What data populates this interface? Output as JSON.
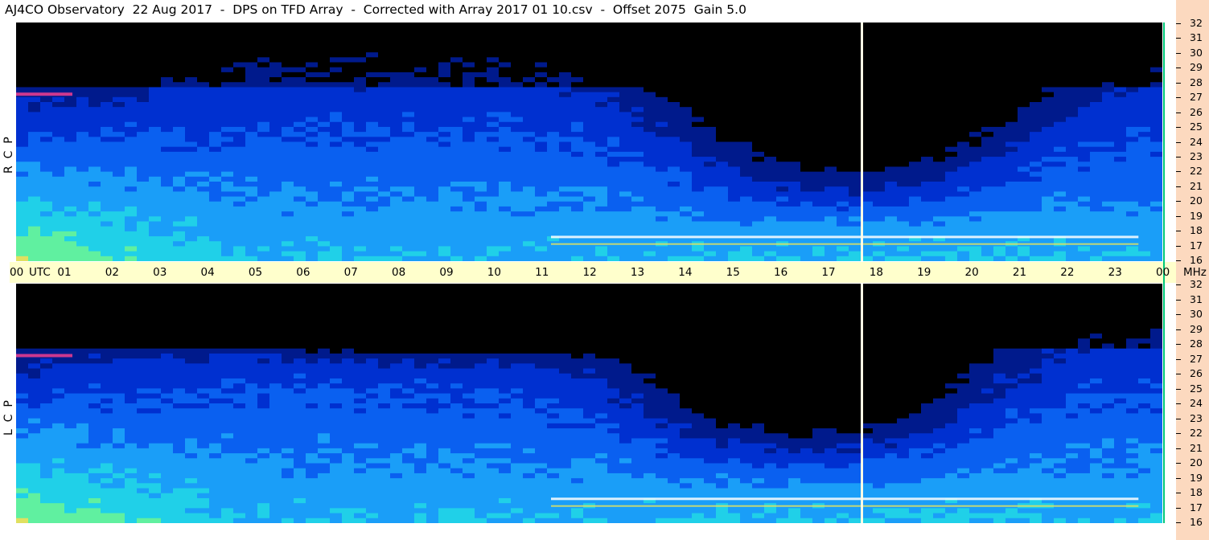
{
  "title": "AJ4CO Observatory  22 Aug 2017  -  DPS on TFD Array  -  Corrected with Array 2017 01 10.csv  -  Offset 2075  Gain 5.0",
  "chart_data": {
    "type": "heatmap",
    "title": "AJ4CO Observatory  22 Aug 2017  -  DPS on TFD Array  -  Corrected with Array 2017 01 10.csv  -  Offset 2075  Gain 5.0",
    "x_unit": "UTC",
    "y_unit": "MHz",
    "x_ticks": [
      "00",
      "01",
      "02",
      "03",
      "04",
      "05",
      "06",
      "07",
      "08",
      "09",
      "10",
      "11",
      "12",
      "13",
      "14",
      "15",
      "16",
      "17",
      "18",
      "19",
      "20",
      "21",
      "22",
      "23",
      "00"
    ],
    "y_ticks": [
      32,
      31,
      30,
      29,
      28,
      27,
      26,
      25,
      24,
      23,
      22,
      21,
      20,
      19,
      18,
      17,
      16
    ],
    "xlim": [
      0,
      24
    ],
    "ylim": [
      16,
      32
    ],
    "panels": [
      {
        "name": "RCP",
        "label": "R  C  P"
      },
      {
        "name": "LCP",
        "label": "L  C  P"
      }
    ],
    "colormap": [
      "#000000",
      "#001a8c",
      "#0030d0",
      "#0a60f0",
      "#1a9ef8",
      "#20d0e8",
      "#60f0a0",
      "#e0e060",
      "#ff4090",
      "#ffffff"
    ],
    "data_gap_utc": 17.7
  }
}
